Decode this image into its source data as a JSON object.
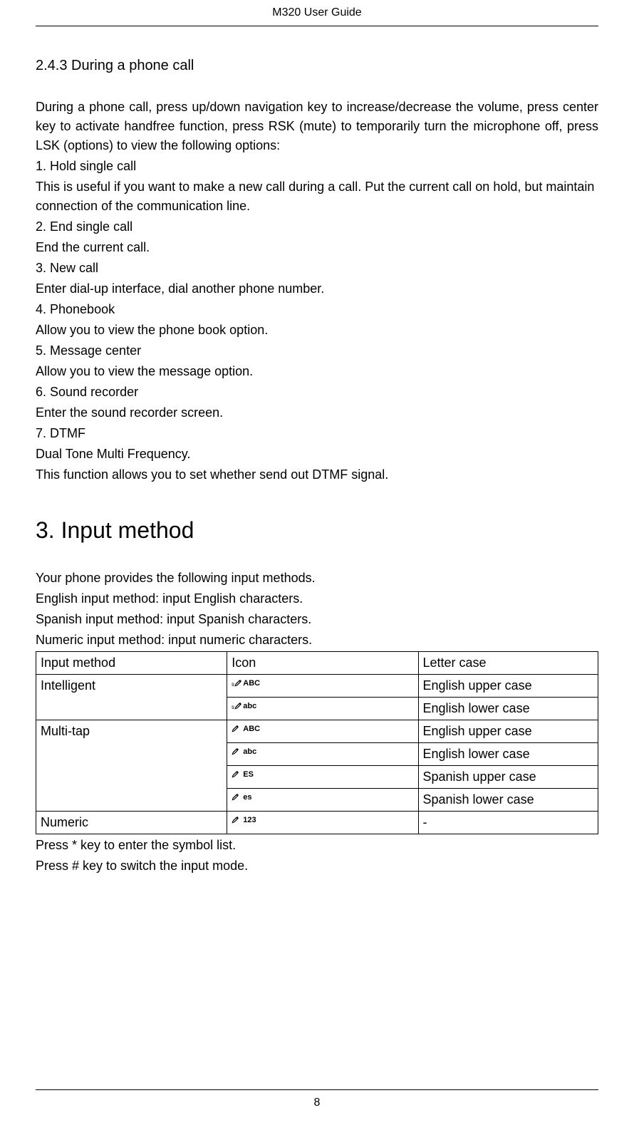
{
  "header": {
    "title": "M320 User Guide"
  },
  "section1": {
    "heading": "2.4.3 During a phone call",
    "intro": "During a phone call, press up/down navigation key to increase/decrease the volume, press center key to activate handfree function, press RSK (mute) to temporarily turn the microphone off, press LSK (options) to view the following options:",
    "options": [
      {
        "title": "1. Hold single call",
        "desc": "This is useful if you want to make a new call during a call. Put the current call on hold, but maintain connection of the communication line."
      },
      {
        "title": "2. End single call",
        "desc": "End the current call."
      },
      {
        "title": "3. New call",
        "desc": "Enter dial-up interface, dial another phone number."
      },
      {
        "title": "4. Phonebook",
        "desc": "Allow you to view the phone book option."
      },
      {
        "title": "5. Message center",
        "desc": "Allow you to view the message option."
      },
      {
        "title": "6. Sound recorder",
        "desc": "Enter the sound recorder screen."
      },
      {
        "title": "7. DTMF",
        "desc": "Dual Tone Multi Frequency."
      }
    ],
    "extra": "This function allows you to set whether send out DTMF signal."
  },
  "section2": {
    "heading": "3. Input method",
    "intro1": "Your phone provides the following input methods.",
    "intro2": "English input method: input English characters.",
    "intro3": "Spanish input method: input Spanish characters.",
    "intro4": "Numeric input method: input numeric characters.",
    "table": {
      "header": {
        "c1": "Input method",
        "c2": "Icon",
        "c3": "Letter case"
      },
      "rows": [
        {
          "method": "Intelligent",
          "rowspan": 2,
          "icon": "s✎ ABC",
          "case": "English upper case",
          "smart": true,
          "label": "ABC"
        },
        {
          "icon": "s✎ abc",
          "case": "English lower case",
          "smart": true,
          "label": "abc"
        },
        {
          "method": "Multi-tap",
          "rowspan": 4,
          "icon": "✎ ABC",
          "case": "English upper case",
          "smart": false,
          "label": "ABC"
        },
        {
          "icon": "✎ abc",
          "case": "English lower case",
          "smart": false,
          "label": "abc"
        },
        {
          "icon": "✎ ES",
          "case": "Spanish upper case",
          "smart": false,
          "label": "ES"
        },
        {
          "icon": "✎ es",
          "case": "Spanish lower case",
          "smart": false,
          "label": "es"
        },
        {
          "method": "Numeric",
          "rowspan": 1,
          "icon": "✎ 123",
          "case": "-",
          "smart": false,
          "label": "123"
        }
      ]
    },
    "note1": "Press * key to enter the symbol list.",
    "note2": "Press # key to switch the input mode."
  },
  "footer": {
    "page": "8"
  }
}
